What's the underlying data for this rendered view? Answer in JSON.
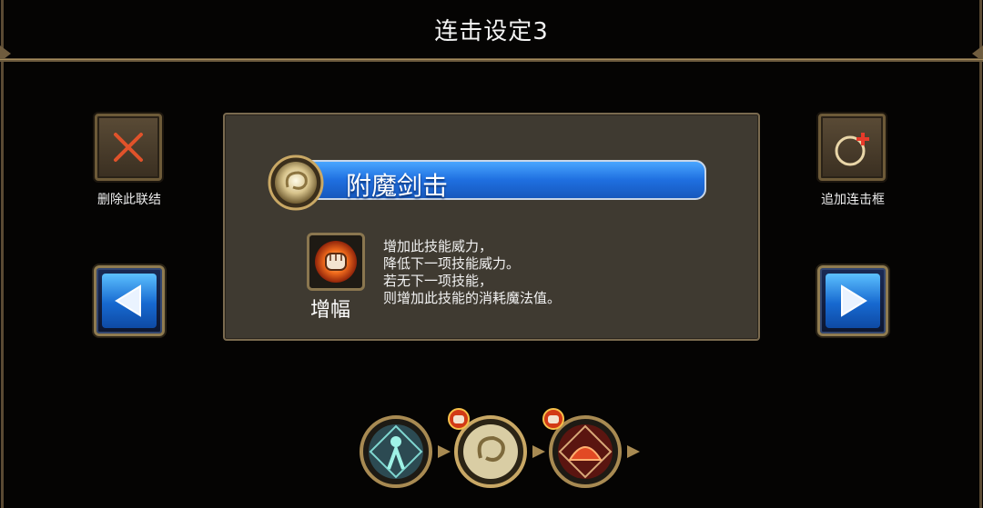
{
  "header": {
    "title": "连击设定3"
  },
  "left_panel": {
    "delete_label": "删除此联结"
  },
  "right_panel": {
    "add_label": "追加连击框"
  },
  "skill": {
    "name": "附魔剑击",
    "effect_label": "增幅",
    "description_lines": [
      "增加此技能威力，",
      "降低下一项技能威力。",
      "若无下一项技能，",
      "则增加此技能的消耗魔法值。"
    ]
  },
  "combo_chain": [
    {
      "icon": "cyan-warrior-skill-icon"
    },
    {
      "icon": "golden-swirl-skill-icon",
      "badge": "fist-badge"
    },
    {
      "icon": "red-dome-skill-icon",
      "badge": "fist-badge"
    }
  ],
  "colors": {
    "skill_bar": "#1f6fe0",
    "panel": "#3f3a31",
    "frame_gold": "#8f7b50",
    "delete_x": "#e0522a"
  }
}
